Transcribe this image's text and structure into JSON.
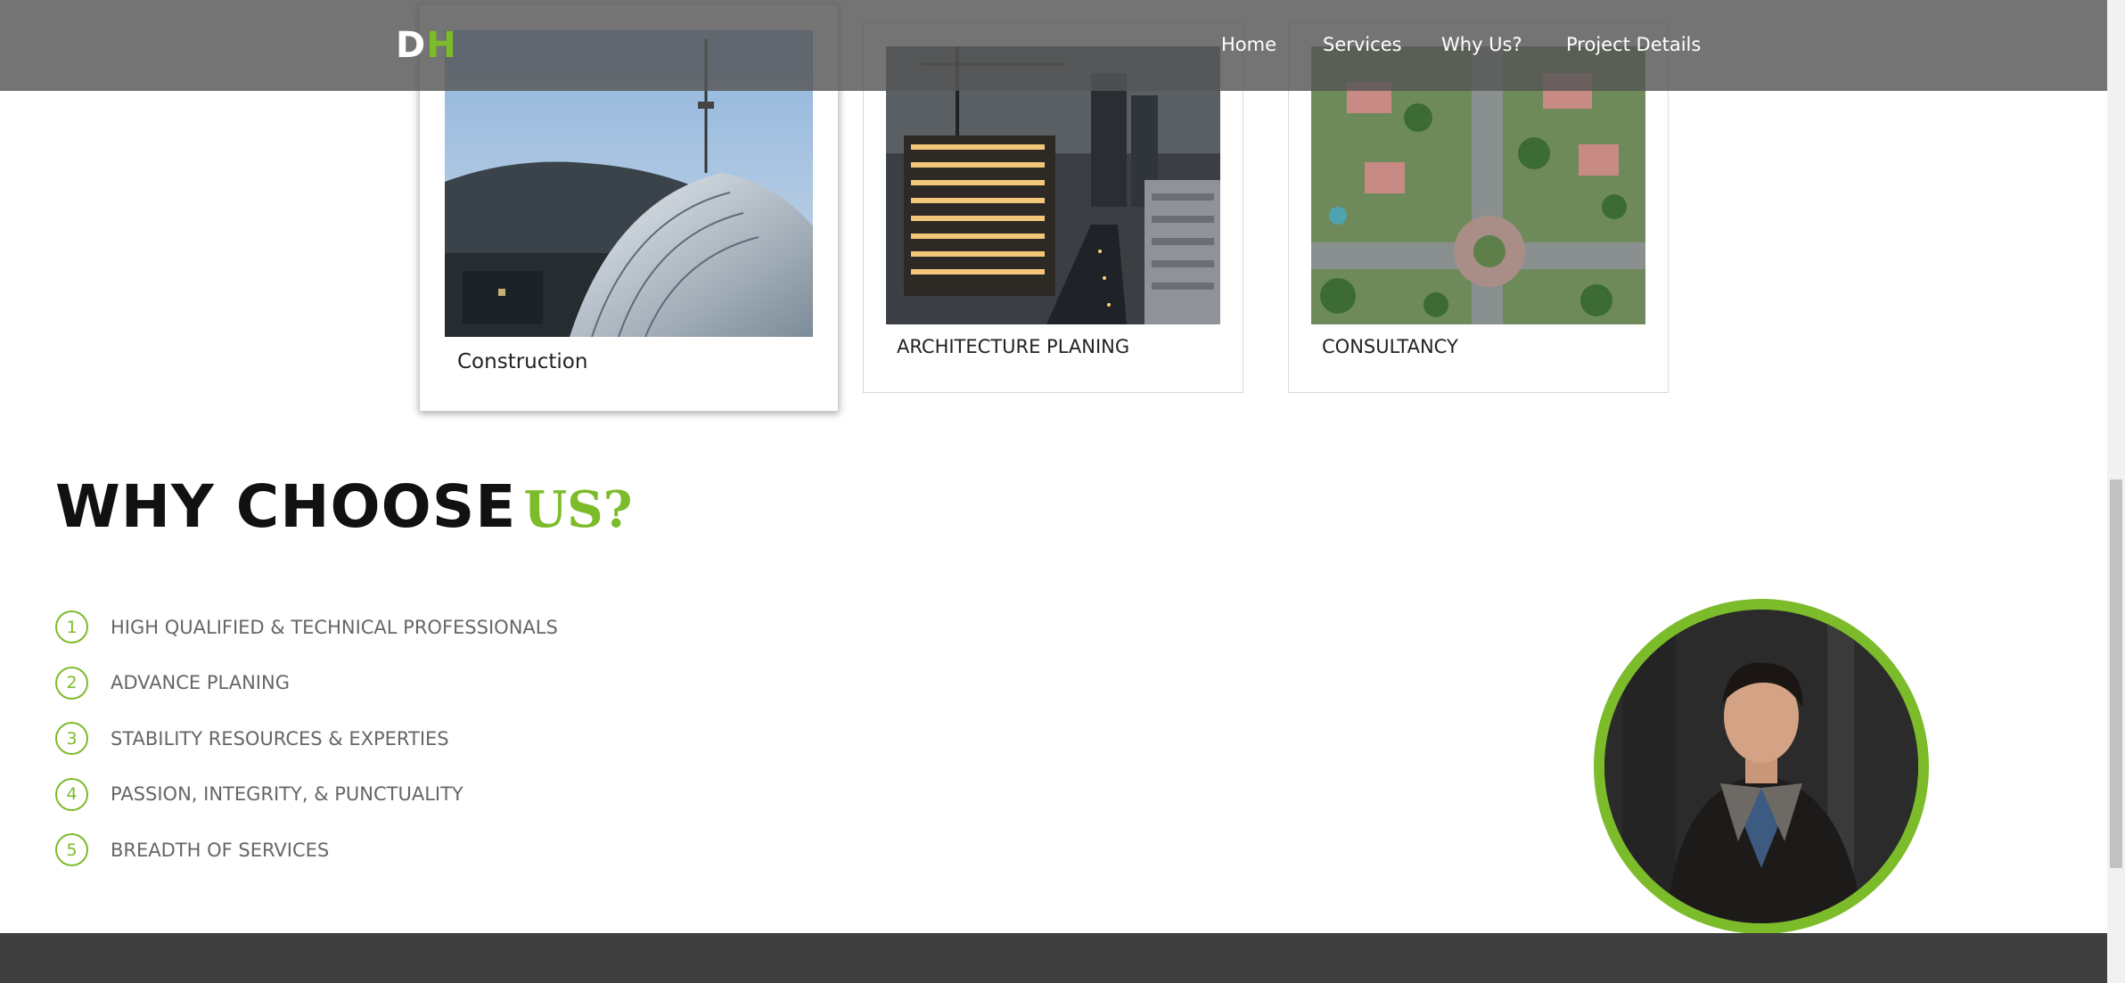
{
  "navbar": {
    "logo_d": "D",
    "logo_h": "H",
    "links": [
      "Home",
      "Services",
      "Why Us?",
      "Project Details"
    ]
  },
  "services": [
    {
      "label": "Construction",
      "image": "dome-tower-photo"
    },
    {
      "label": "ARCHITECTURE PLANING",
      "image": "city-construction-night-photo"
    },
    {
      "label": "CONSULTANCY",
      "image": "aerial-neighborhood-photo"
    }
  ],
  "why": {
    "title_main": "WHY CHOOSE",
    "title_accent": "US?",
    "items": [
      {
        "num": "1",
        "text": "HIGH QUALIFIED & TECHNICAL PROFESSIONALS"
      },
      {
        "num": "2",
        "text": "ADVANCE PLANING"
      },
      {
        "num": "3",
        "text": "STABILITY RESOURCES & EXPERTIES"
      },
      {
        "num": "4",
        "text": "PASSION, INTEGRITY, & PUNCTUALITY"
      },
      {
        "num": "5",
        "text": "BREADTH OF SERVICES"
      }
    ]
  },
  "colors": {
    "accent": "#7cbb2a",
    "navbar": "#555555",
    "footer": "#3f3f3f"
  }
}
